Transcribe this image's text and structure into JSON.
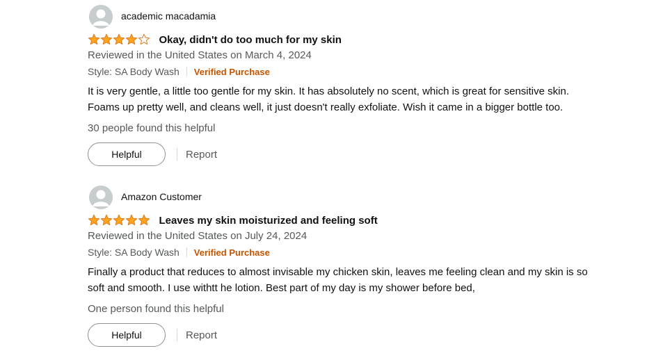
{
  "reviews": [
    {
      "reviewer": "academic macadamia",
      "rating": 4,
      "title": "Okay, didn't do too much for my skin",
      "date": "Reviewed in the United States on March 4, 2024",
      "style": "Style: SA Body Wash",
      "verified": "Verified Purchase",
      "body_lines": [
        "It is very gentle, a little too gentle for my skin. It has absolutely no scent, which is great for sensitive skin.",
        "Foams up pretty well, and cleans well, it just doesn't really exfoliate. Wish it came in a bigger bottle too."
      ],
      "helpful_count": "30 people found this helpful",
      "helpful_label": "Helpful",
      "report_label": "Report"
    },
    {
      "reviewer": "Amazon Customer",
      "rating": 5,
      "title": "Leaves my skin moisturized and feeling soft",
      "date": "Reviewed in the United States on July 24, 2024",
      "style": "Style: SA Body Wash",
      "verified": "Verified Purchase",
      "body_lines": [
        "Finally a product that reduces to almost invisable my chicken skin, leaves me feeling clean and my skin is so",
        "soft and smooth. I use withtt he lotion. Best part of my day is my shower before bed,"
      ],
      "helpful_count": "One person found this helpful",
      "helpful_label": "Helpful",
      "report_label": "Report"
    }
  ],
  "colors": {
    "star_fill": "#ffa41c",
    "star_border": "#de7921",
    "verified": "#c45500",
    "secondary_text": "#565959"
  },
  "icons": {
    "avatar": "default-profile-icon",
    "star_filled": "star-filled-icon",
    "star_empty": "star-empty-icon"
  }
}
